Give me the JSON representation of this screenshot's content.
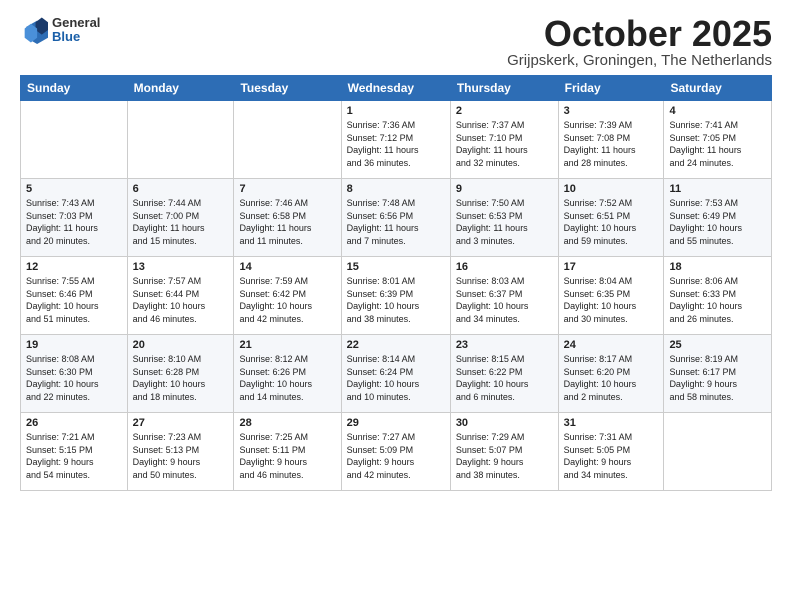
{
  "header": {
    "logo_general": "General",
    "logo_blue": "Blue",
    "month_title": "October 2025",
    "location": "Grijpskerk, Groningen, The Netherlands"
  },
  "weekdays": [
    "Sunday",
    "Monday",
    "Tuesday",
    "Wednesday",
    "Thursday",
    "Friday",
    "Saturday"
  ],
  "weeks": [
    [
      {
        "day": "",
        "info": ""
      },
      {
        "day": "",
        "info": ""
      },
      {
        "day": "",
        "info": ""
      },
      {
        "day": "1",
        "info": "Sunrise: 7:36 AM\nSunset: 7:12 PM\nDaylight: 11 hours\nand 36 minutes."
      },
      {
        "day": "2",
        "info": "Sunrise: 7:37 AM\nSunset: 7:10 PM\nDaylight: 11 hours\nand 32 minutes."
      },
      {
        "day": "3",
        "info": "Sunrise: 7:39 AM\nSunset: 7:08 PM\nDaylight: 11 hours\nand 28 minutes."
      },
      {
        "day": "4",
        "info": "Sunrise: 7:41 AM\nSunset: 7:05 PM\nDaylight: 11 hours\nand 24 minutes."
      }
    ],
    [
      {
        "day": "5",
        "info": "Sunrise: 7:43 AM\nSunset: 7:03 PM\nDaylight: 11 hours\nand 20 minutes."
      },
      {
        "day": "6",
        "info": "Sunrise: 7:44 AM\nSunset: 7:00 PM\nDaylight: 11 hours\nand 15 minutes."
      },
      {
        "day": "7",
        "info": "Sunrise: 7:46 AM\nSunset: 6:58 PM\nDaylight: 11 hours\nand 11 minutes."
      },
      {
        "day": "8",
        "info": "Sunrise: 7:48 AM\nSunset: 6:56 PM\nDaylight: 11 hours\nand 7 minutes."
      },
      {
        "day": "9",
        "info": "Sunrise: 7:50 AM\nSunset: 6:53 PM\nDaylight: 11 hours\nand 3 minutes."
      },
      {
        "day": "10",
        "info": "Sunrise: 7:52 AM\nSunset: 6:51 PM\nDaylight: 10 hours\nand 59 minutes."
      },
      {
        "day": "11",
        "info": "Sunrise: 7:53 AM\nSunset: 6:49 PM\nDaylight: 10 hours\nand 55 minutes."
      }
    ],
    [
      {
        "day": "12",
        "info": "Sunrise: 7:55 AM\nSunset: 6:46 PM\nDaylight: 10 hours\nand 51 minutes."
      },
      {
        "day": "13",
        "info": "Sunrise: 7:57 AM\nSunset: 6:44 PM\nDaylight: 10 hours\nand 46 minutes."
      },
      {
        "day": "14",
        "info": "Sunrise: 7:59 AM\nSunset: 6:42 PM\nDaylight: 10 hours\nand 42 minutes."
      },
      {
        "day": "15",
        "info": "Sunrise: 8:01 AM\nSunset: 6:39 PM\nDaylight: 10 hours\nand 38 minutes."
      },
      {
        "day": "16",
        "info": "Sunrise: 8:03 AM\nSunset: 6:37 PM\nDaylight: 10 hours\nand 34 minutes."
      },
      {
        "day": "17",
        "info": "Sunrise: 8:04 AM\nSunset: 6:35 PM\nDaylight: 10 hours\nand 30 minutes."
      },
      {
        "day": "18",
        "info": "Sunrise: 8:06 AM\nSunset: 6:33 PM\nDaylight: 10 hours\nand 26 minutes."
      }
    ],
    [
      {
        "day": "19",
        "info": "Sunrise: 8:08 AM\nSunset: 6:30 PM\nDaylight: 10 hours\nand 22 minutes."
      },
      {
        "day": "20",
        "info": "Sunrise: 8:10 AM\nSunset: 6:28 PM\nDaylight: 10 hours\nand 18 minutes."
      },
      {
        "day": "21",
        "info": "Sunrise: 8:12 AM\nSunset: 6:26 PM\nDaylight: 10 hours\nand 14 minutes."
      },
      {
        "day": "22",
        "info": "Sunrise: 8:14 AM\nSunset: 6:24 PM\nDaylight: 10 hours\nand 10 minutes."
      },
      {
        "day": "23",
        "info": "Sunrise: 8:15 AM\nSunset: 6:22 PM\nDaylight: 10 hours\nand 6 minutes."
      },
      {
        "day": "24",
        "info": "Sunrise: 8:17 AM\nSunset: 6:20 PM\nDaylight: 10 hours\nand 2 minutes."
      },
      {
        "day": "25",
        "info": "Sunrise: 8:19 AM\nSunset: 6:17 PM\nDaylight: 9 hours\nand 58 minutes."
      }
    ],
    [
      {
        "day": "26",
        "info": "Sunrise: 7:21 AM\nSunset: 5:15 PM\nDaylight: 9 hours\nand 54 minutes."
      },
      {
        "day": "27",
        "info": "Sunrise: 7:23 AM\nSunset: 5:13 PM\nDaylight: 9 hours\nand 50 minutes."
      },
      {
        "day": "28",
        "info": "Sunrise: 7:25 AM\nSunset: 5:11 PM\nDaylight: 9 hours\nand 46 minutes."
      },
      {
        "day": "29",
        "info": "Sunrise: 7:27 AM\nSunset: 5:09 PM\nDaylight: 9 hours\nand 42 minutes."
      },
      {
        "day": "30",
        "info": "Sunrise: 7:29 AM\nSunset: 5:07 PM\nDaylight: 9 hours\nand 38 minutes."
      },
      {
        "day": "31",
        "info": "Sunrise: 7:31 AM\nSunset: 5:05 PM\nDaylight: 9 hours\nand 34 minutes."
      },
      {
        "day": "",
        "info": ""
      }
    ]
  ]
}
